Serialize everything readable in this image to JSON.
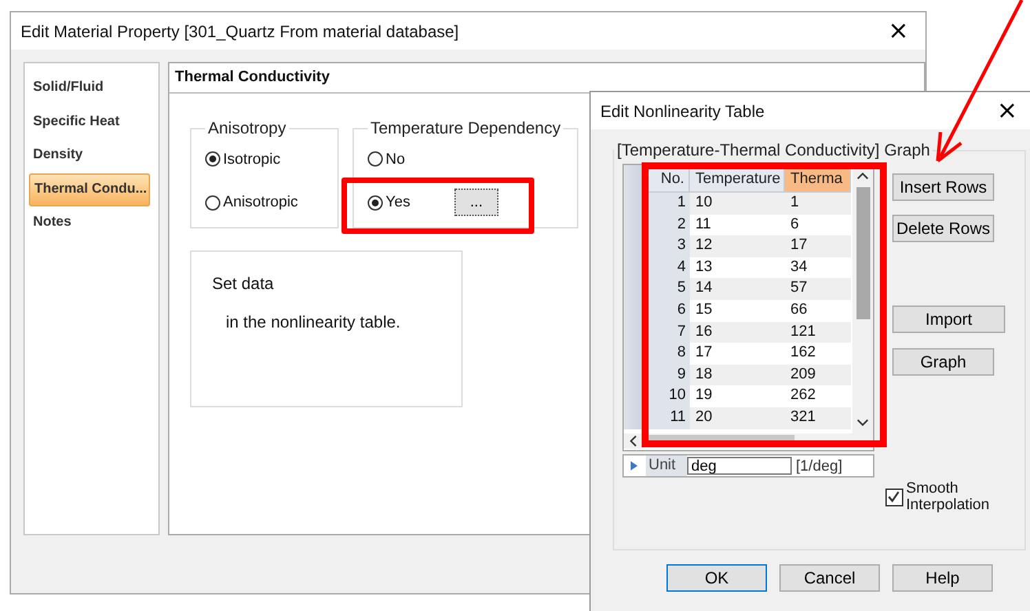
{
  "main_window": {
    "title": "Edit Material Property [301_Quartz From material database]",
    "close": "×"
  },
  "sidebar": {
    "items": [
      {
        "label": "Solid/Fluid",
        "selected": false
      },
      {
        "label": "Specific Heat",
        "selected": false
      },
      {
        "label": "Density",
        "selected": false
      },
      {
        "label": "Thermal Condu...",
        "selected": true
      },
      {
        "label": "Notes",
        "selected": false
      }
    ]
  },
  "panel": {
    "title": "Thermal Conductivity",
    "anisotropy": {
      "title": "Anisotropy",
      "options": [
        {
          "label": "Isotropic",
          "selected": true
        },
        {
          "label": "Anisotropic",
          "selected": false
        }
      ]
    },
    "temperature_dependency": {
      "title": "Temperature Dependency",
      "options": [
        {
          "label": "No",
          "selected": false
        },
        {
          "label": "Yes",
          "selected": true
        }
      ],
      "button": "..."
    },
    "note": [
      "Set data",
      "in the nonlinearity table."
    ]
  },
  "dialog": {
    "title": "Edit Nonlinearity Table",
    "close": "×",
    "group_title": "[Temperature-Thermal Conductivity] Graph",
    "table": {
      "columns": [
        {
          "label": "No.",
          "selected": false
        },
        {
          "label": "Temperature",
          "selected": false
        },
        {
          "label": "Therma",
          "selected": true
        }
      ],
      "rows": [
        [
          "1",
          "10",
          "1"
        ],
        [
          "2",
          "11",
          "6"
        ],
        [
          "3",
          "12",
          "17"
        ],
        [
          "4",
          "13",
          "34"
        ],
        [
          "5",
          "14",
          "57"
        ],
        [
          "6",
          "15",
          "66"
        ],
        [
          "7",
          "16",
          "121"
        ],
        [
          "8",
          "17",
          "162"
        ],
        [
          "9",
          "18",
          "209"
        ],
        [
          "10",
          "19",
          "262"
        ],
        [
          "11",
          "20",
          "321"
        ]
      ]
    },
    "unit": {
      "label": "Unit",
      "value": "deg",
      "unit": "[1/deg]"
    },
    "side_buttons": [
      "Insert Rows",
      "Delete Rows",
      "Import",
      "Graph"
    ],
    "smooth_interpolation": {
      "label": "Smooth Interpolation",
      "checked": true
    },
    "buttons": [
      {
        "label": "OK",
        "default": true
      },
      {
        "label": "Cancel",
        "default": false
      },
      {
        "label": "Help",
        "default": false
      }
    ]
  }
}
